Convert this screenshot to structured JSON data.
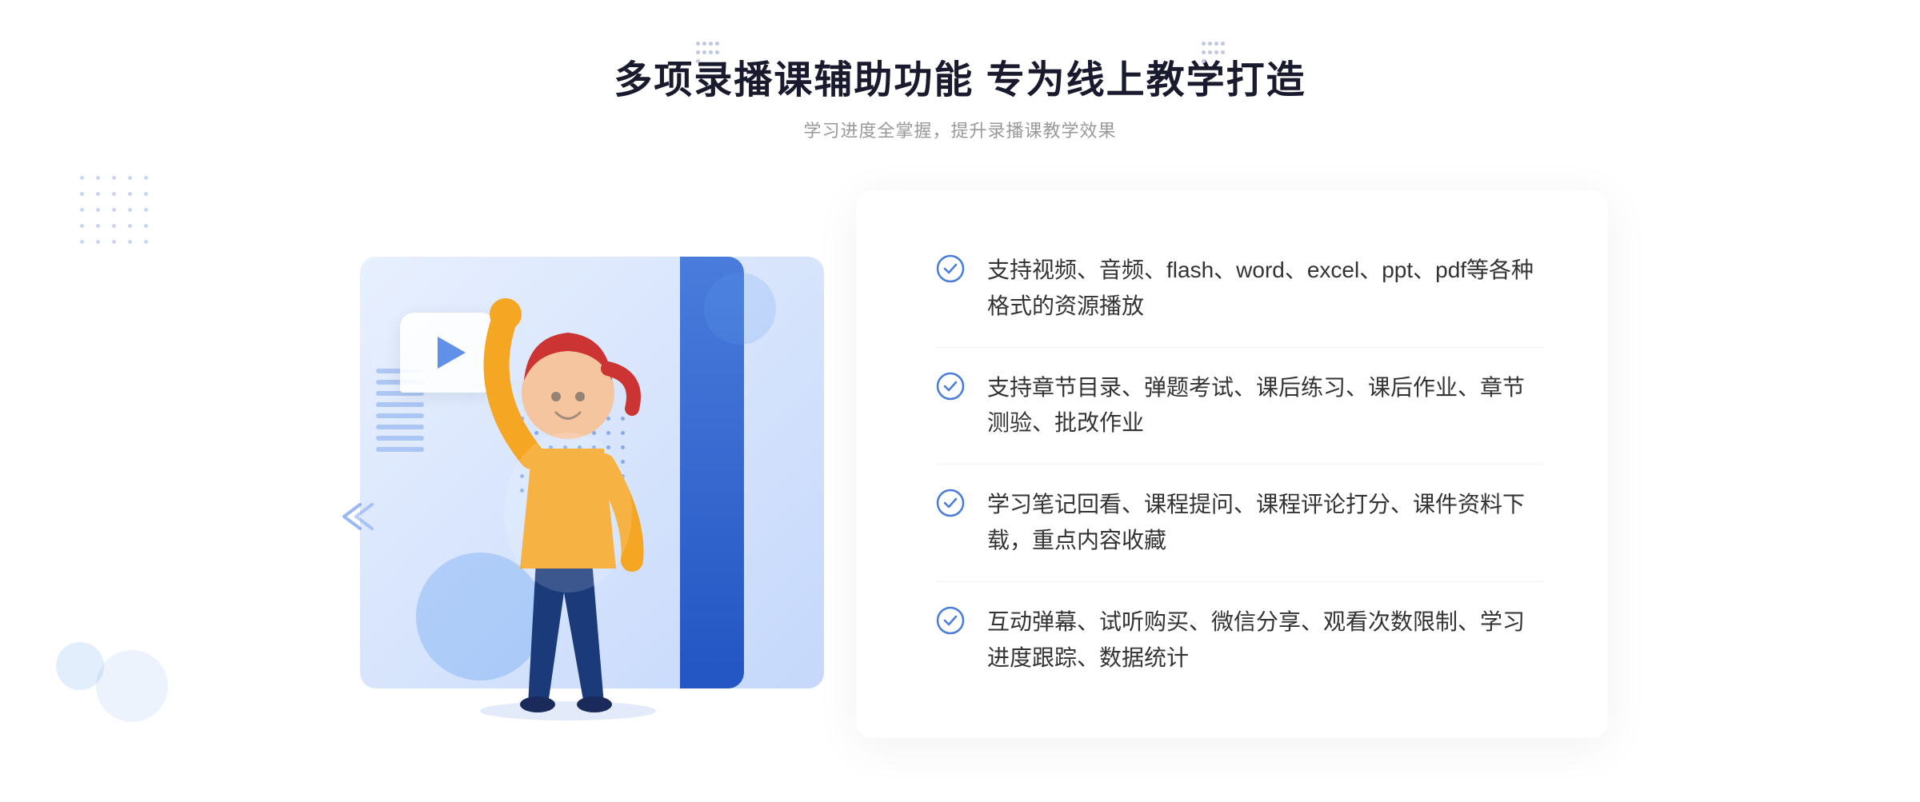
{
  "header": {
    "title": "多项录播课辅助功能 专为线上教学打造",
    "subtitle": "学习进度全掌握，提升录播课教学效果"
  },
  "features": [
    {
      "id": 1,
      "text": "支持视频、音频、flash、word、excel、ppt、pdf等各种格式的资源播放"
    },
    {
      "id": 2,
      "text": "支持章节目录、弹题考试、课后练习、课后作业、章节测验、批改作业"
    },
    {
      "id": 3,
      "text": "学习笔记回看、课程提问、课程评论打分、课件资料下载，重点内容收藏"
    },
    {
      "id": 4,
      "text": "互动弹幕、试听购买、微信分享、观看次数限制、学习进度跟踪、数据统计"
    }
  ],
  "colors": {
    "primary_blue": "#3d7ae5",
    "light_blue": "#6090e8",
    "text_dark": "#1a1a2e",
    "text_gray": "#999999",
    "text_body": "#333333",
    "accent": "#4a7cdc"
  },
  "deco": {
    "chevron_label": "»",
    "play_label": "▶"
  }
}
